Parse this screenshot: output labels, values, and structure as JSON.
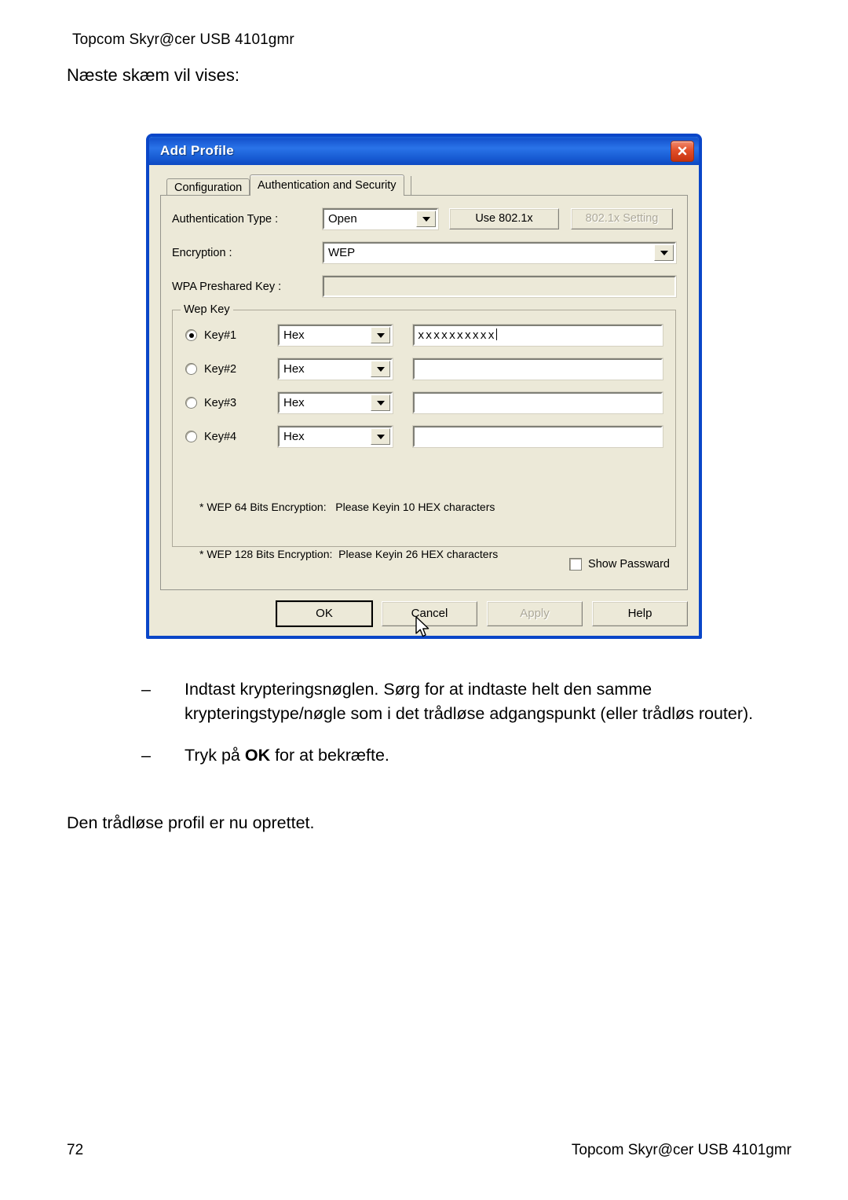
{
  "document": {
    "header": "Topcom Skyr@cer USB 4101gmr",
    "intro": "Næste skæm vil vises:",
    "bullets": [
      {
        "marker": "–",
        "text_before_bold": "Indtast krypteringsnøglen. Sørg for at indtaste helt den samme krypteringstype/nøgle som i det trådløse adgangspunkt (eller trådløs router).",
        "bold": "",
        "text_after_bold": ""
      },
      {
        "marker": "–",
        "text_before_bold": "Tryk på ",
        "bold": "OK",
        "text_after_bold": " for at bekræfte."
      }
    ],
    "closing": "Den trådløse profil er nu oprettet.",
    "footer_page_number": "72",
    "footer_title": "Topcom Skyr@cer USB 4101gmr"
  },
  "dialog": {
    "title": "Add Profile",
    "close_icon": "close-icon",
    "tabs": [
      {
        "label": "Configuration",
        "active": false
      },
      {
        "label": "Authentication and Security",
        "active": true
      }
    ],
    "fields": {
      "auth_type_label": "Authentication Type :",
      "auth_type_value": "Open",
      "use_8021x_label": "Use 802.1x",
      "setting_8021x_label": "802.1x Setting",
      "encryption_label": "Encryption :",
      "encryption_value": "WEP",
      "wpa_label": "WPA Preshared Key :",
      "wpa_value": ""
    },
    "wep_group": {
      "legend": "Wep Key",
      "keys": [
        {
          "label": "Key#1",
          "selected": true,
          "format": "Hex",
          "value": "xxxxxxxxxx"
        },
        {
          "label": "Key#2",
          "selected": false,
          "format": "Hex",
          "value": ""
        },
        {
          "label": "Key#3",
          "selected": false,
          "format": "Hex",
          "value": ""
        },
        {
          "label": "Key#4",
          "selected": false,
          "format": "Hex",
          "value": ""
        }
      ],
      "hint_line_1": "* WEP 64 Bits Encryption:   Please Keyin 10 HEX characters",
      "hint_line_2": "* WEP 128 Bits Encryption:  Please Keyin 26 HEX characters"
    },
    "show_password_label": "Show Passward",
    "show_password_checked": false,
    "buttons": {
      "ok": "OK",
      "cancel": "Cancel",
      "apply": "Apply",
      "help": "Help"
    },
    "colors": {
      "titlebar": "#1554cf",
      "window_face": "#ece9d8",
      "close_button": "#e2502a",
      "border": "#0a46c8",
      "disabled_text": "#aca899"
    }
  }
}
